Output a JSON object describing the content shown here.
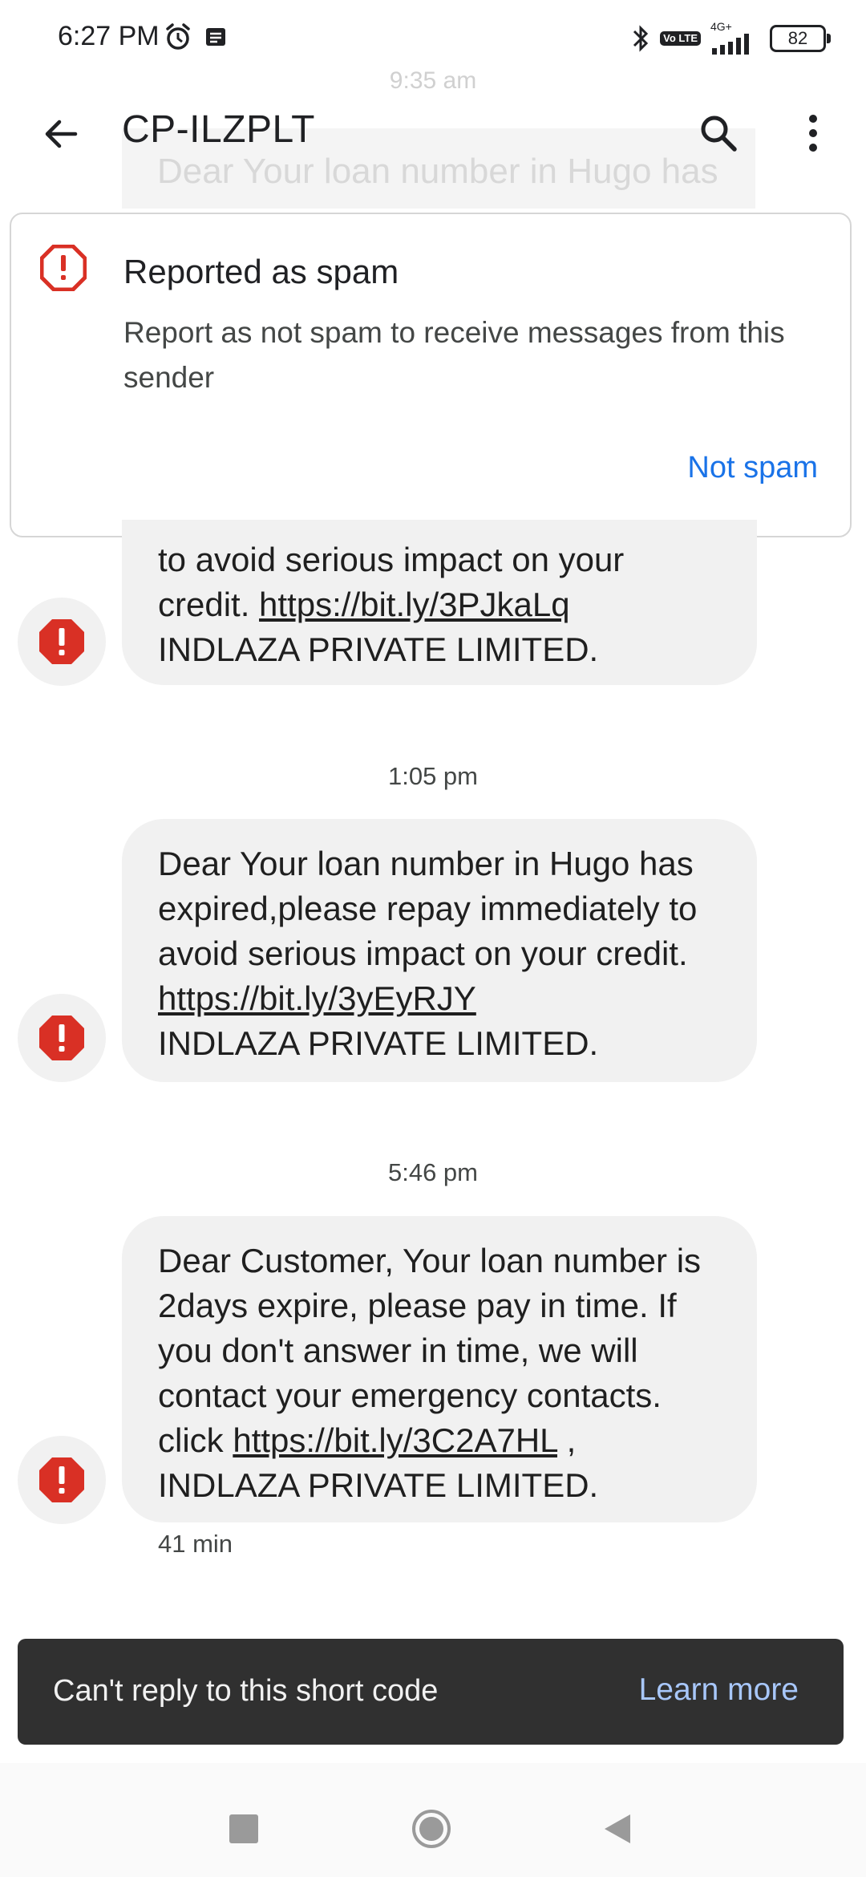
{
  "status_bar": {
    "time": "6:27 PM",
    "network": "4G+",
    "volte": "Vo LTE",
    "battery": "82"
  },
  "app_bar": {
    "title": "CP-ILZPLT"
  },
  "faded_header": {
    "time": "9:35 am",
    "text": "Dear Your loan number in Hugo has"
  },
  "spam_card": {
    "title": "Reported as spam",
    "description": "Report as not spam to receive messages from this sender",
    "action": "Not spam"
  },
  "messages": [
    {
      "time": "",
      "text_before": "to avoid serious impact on your credit. ",
      "link": "https://bit.ly/3PJkaLq",
      "text_after": "INDLAZA PRIVATE LIMITED."
    },
    {
      "time": "1:05 pm",
      "text_before": "Dear Your loan number in Hugo has expired,please repay immediately to avoid serious impact on your credit. ",
      "link": "https://bit.ly/3yEyRJY",
      "text_after": "INDLAZA PRIVATE LIMITED."
    },
    {
      "time": "5:46 pm",
      "text_before": "Dear Customer, Your loan number is 2days expire, please pay in time. If you don't answer in time, we will contact your emergency contacts. click ",
      "link": "https://bit.ly/3C2A7HL",
      "text_after": ", INDLAZA PRIVATE LIMITED.",
      "meta": "41 min"
    }
  ],
  "snackbar": {
    "text": "Can't reply to this short code",
    "action": "Learn more"
  },
  "colors": {
    "accent": "#1a73e8",
    "spam_red": "#d93025",
    "bubble_bg": "#f1f1f1",
    "snackbar_bg": "#303030",
    "snackbar_action": "#a8c7fa"
  }
}
